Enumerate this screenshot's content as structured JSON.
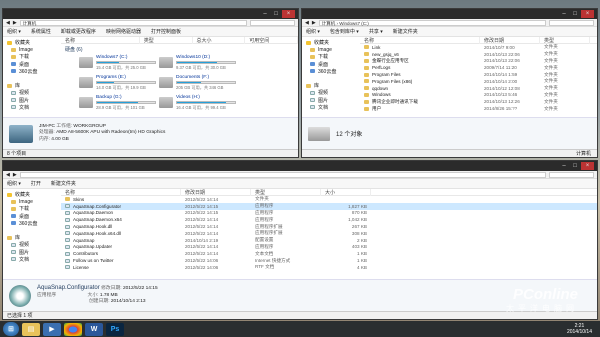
{
  "w1": {
    "title": "",
    "address": "计算机",
    "toolbar": [
      "组织 ▾",
      "系统属性",
      "卸载或更改程序",
      "映射网络驱动器",
      "打开控制面板"
    ],
    "nav": [
      {
        "label": "收藏夹",
        "icon": "favorites-star-icon",
        "sub": false
      },
      {
        "label": "Image",
        "icon": "folder-icon",
        "sub": true
      },
      {
        "label": "下载",
        "icon": "folder-icon",
        "sub": true
      },
      {
        "label": "桌面",
        "icon": "desktop-icon",
        "sub": true
      },
      {
        "label": "360云盘",
        "icon": "cloud-icon",
        "sub": true
      },
      {
        "label": "",
        "icon": "",
        "sub": false
      },
      {
        "label": "库",
        "icon": "library-icon",
        "sub": false
      },
      {
        "label": "视频",
        "icon": "video-icon",
        "sub": true
      },
      {
        "label": "图片",
        "icon": "picture-icon",
        "sub": true
      },
      {
        "label": "文档",
        "icon": "document-icon",
        "sub": true
      }
    ],
    "headers": [
      "名称",
      "类型",
      "总大小",
      "可用空间"
    ],
    "group": "硬盘 (6)",
    "drives": [
      {
        "name": "Windows7 (C:)",
        "size": "15.4 GB 可用，共 25.0 GB",
        "fill": 0.38
      },
      {
        "name": "Windows10 (D:)",
        "size": "9.37 GB 可用，共 30.0 GB",
        "fill": 0.69
      },
      {
        "name": "Programs (E:)",
        "size": "14.0 GB 可用，共 19.9 GB",
        "fill": 0.3
      },
      {
        "name": "Documents (F:)",
        "size": "205 GB 可用，共 346 GB",
        "fill": 0.41
      },
      {
        "name": "Backup (G:)",
        "size": "28.9 GB 可用，共 101 GB",
        "fill": 0.71
      },
      {
        "name": "Videos (H:)",
        "size": "16.4 GB 可用，共 99.4 GB",
        "fill": 0.84
      }
    ],
    "details": {
      "pc": "JIM-PC",
      "wg_label": "工作组:",
      "wg": "WORKGROUP",
      "cpu_label": "处理器:",
      "cpu": "AMD A8-5600K APU with Radeon(tm) HD Graphics",
      "mem_label": "内存:",
      "mem": "4.00 GB"
    },
    "status": "8 个项目"
  },
  "w2": {
    "title": "",
    "address": "计算机 › Windows7 (C:)",
    "toolbar": [
      "组织 ▾",
      "包含到库中 ▾",
      "共享 ▾",
      "新建文件夹"
    ],
    "nav": [
      {
        "label": "收藏夹",
        "icon": "favorites-star-icon",
        "sub": false
      },
      {
        "label": "Image",
        "icon": "folder-icon",
        "sub": true
      },
      {
        "label": "下载",
        "icon": "folder-icon",
        "sub": true
      },
      {
        "label": "桌面",
        "icon": "desktop-icon",
        "sub": true
      },
      {
        "label": "360云盘",
        "icon": "cloud-icon",
        "sub": true
      },
      {
        "label": "",
        "icon": "",
        "sub": false
      },
      {
        "label": "库",
        "icon": "library-icon",
        "sub": false
      },
      {
        "label": "视频",
        "icon": "video-icon",
        "sub": true
      },
      {
        "label": "图片",
        "icon": "picture-icon",
        "sub": true
      },
      {
        "label": "文档",
        "icon": "document-icon",
        "sub": true
      }
    ],
    "headers": [
      "名称",
      "修改日期",
      "类型"
    ],
    "rows": [
      {
        "name": "Link",
        "date": "2014/10/7 9:00",
        "type": "文件夹"
      },
      {
        "name": "new_gsjq_v6",
        "date": "2014/10/13 22:06",
        "type": "文件夹"
      },
      {
        "name": "金蝶行业应用专区",
        "date": "2014/10/13 22:06",
        "type": "文件夹"
      },
      {
        "name": "PerfLogs",
        "date": "2009/7/14 11:20",
        "type": "文件夹"
      },
      {
        "name": "Program Files",
        "date": "2014/10/14 1:59",
        "type": "文件夹"
      },
      {
        "name": "Program Files (x86)",
        "date": "2014/10/14 2:00",
        "type": "文件夹"
      },
      {
        "name": "qqdown",
        "date": "2014/10/12 12:08",
        "type": "文件夹"
      },
      {
        "name": "Windows",
        "date": "2014/10/13 5:46",
        "type": "文件夹"
      },
      {
        "name": "腾讯企业即时通讯下载",
        "date": "2014/10/13 12:26",
        "type": "文件夹"
      },
      {
        "name": "用户",
        "date": "2014/8/26 15:??",
        "type": "文件夹"
      }
    ],
    "count": "12 个对象",
    "status_right": "计算机"
  },
  "w3": {
    "title": "",
    "address": "",
    "toolbar": [
      "组织 ▾",
      "打开",
      "新建文件夹"
    ],
    "nav": [
      {
        "label": "收藏夹",
        "icon": "favorites-star-icon",
        "sub": false
      },
      {
        "label": "Image",
        "icon": "folder-icon",
        "sub": true
      },
      {
        "label": "下载",
        "icon": "folder-icon",
        "sub": true
      },
      {
        "label": "桌面",
        "icon": "desktop-icon",
        "sub": true
      },
      {
        "label": "360云盘",
        "icon": "cloud-icon",
        "sub": true
      },
      {
        "label": "",
        "icon": "",
        "sub": false
      },
      {
        "label": "库",
        "icon": "library-icon",
        "sub": false
      },
      {
        "label": "视频",
        "icon": "video-icon",
        "sub": true
      },
      {
        "label": "图片",
        "icon": "picture-icon",
        "sub": true
      },
      {
        "label": "文档",
        "icon": "document-icon",
        "sub": true
      }
    ],
    "headers": [
      "名称",
      "修改日期",
      "类型",
      "大小"
    ],
    "rows": [
      {
        "name": "Skins",
        "date": "2012/5/22 14:14",
        "type": "文件夹",
        "size": ""
      },
      {
        "name": "AquaSnap.Configurator",
        "date": "2012/5/22 14:15",
        "type": "应用程序",
        "size": "1,827 KB"
      },
      {
        "name": "AquaSnap.Daemon",
        "date": "2012/5/22 14:15",
        "type": "应用程序",
        "size": "870 KB"
      },
      {
        "name": "AquaSnap.Daemon.x64",
        "date": "2012/5/22 14:14",
        "type": "应用程序",
        "size": "1,042 KB"
      },
      {
        "name": "AquaSnap.Hook.dll",
        "date": "2012/5/22 14:14",
        "type": "应用程序扩展",
        "size": "267 KB"
      },
      {
        "name": "AquaSnap.Hook.x64.dll",
        "date": "2012/5/22 14:14",
        "type": "应用程序扩展",
        "size": "308 KB"
      },
      {
        "name": "AquaSnap",
        "date": "2014/10/14 2:19",
        "type": "配置设置",
        "size": "2 KB"
      },
      {
        "name": "AquaSnap.Updater",
        "date": "2012/5/22 14:14",
        "type": "应用程序",
        "size": "403 KB"
      },
      {
        "name": "Contributors",
        "date": "2012/5/22 14:14",
        "type": "文本文档",
        "size": "1 KB"
      },
      {
        "name": "Follow us on Twitter",
        "date": "2012/5/22 14:06",
        "type": "Internet 快捷方式",
        "size": "1 KB"
      },
      {
        "name": "License",
        "date": "2012/5/22 14:06",
        "type": "RTF 文档",
        "size": "4 KB"
      }
    ],
    "detail": {
      "name": "AquaSnap.Configurator",
      "kind": "应用程序",
      "mod_label": "修改日期:",
      "mod": "2012/5/22 14:15",
      "size_label": "大小:",
      "size": "1.78 MB",
      "created_label": "创建日期:",
      "created": "2014/10/14 2:13"
    },
    "status": "已选择 1 项"
  },
  "taskbar": {
    "time": "2:21",
    "date": "2014/10/14"
  },
  "watermark": {
    "brand": "PConline",
    "cn": "太平洋电脑网"
  }
}
